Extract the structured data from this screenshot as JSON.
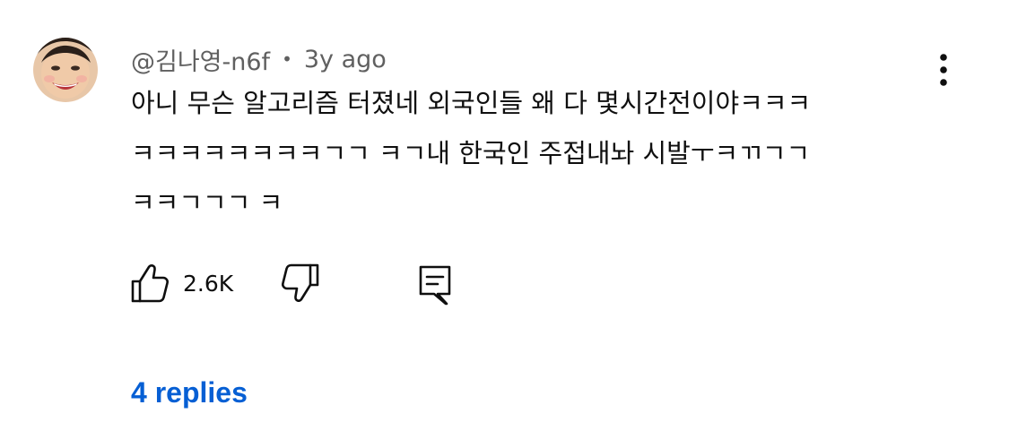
{
  "comment": {
    "author": "@김나영-n6f",
    "separator": "•",
    "time_ago": "3y ago",
    "text_lines": [
      "아니 무슨 알고리즘 터졌네 외국인들 왜 다 몇시간전이야ㅋㅋㅋ",
      "ㅋㅋㅋㅋㅋㅋㅋㅋㄱㄱ ㅋㄱ내 한국인 주접내놔 시발ㅜㅋㄲㄱㄱ",
      "ㅋㅋㄱㄱㄱ ㅋ"
    ],
    "like_count": "2.6K",
    "replies_label": "4 replies"
  },
  "icons": {
    "avatar": "avatar-photo",
    "more": "more-vert-icon",
    "like": "thumb-up-icon",
    "dislike": "thumb-down-icon",
    "reply": "comment-reply-icon"
  },
  "colors": {
    "text": "#0f0f0f",
    "meta": "#606060",
    "link": "#065fd4",
    "background": "#ffffff"
  }
}
